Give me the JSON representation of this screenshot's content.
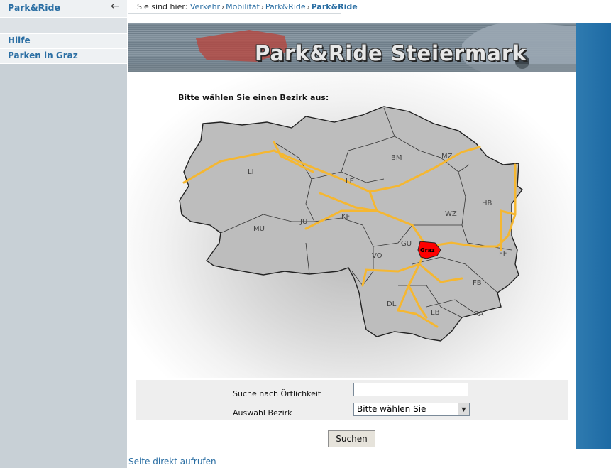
{
  "sidebar": {
    "title": "Park&Ride",
    "back_icon": "arrow-left-icon",
    "items": [
      {
        "label": "Hilfe"
      },
      {
        "label": "Parken in Graz"
      }
    ]
  },
  "breadcrumb": {
    "prefix": "Sie sind hier:",
    "items": [
      "Verkehr",
      "Mobilität",
      "Park&Ride"
    ],
    "current": "Park&Ride",
    "separator": "›"
  },
  "banner": {
    "title": "Park&Ride Steiermark"
  },
  "map": {
    "prompt": "Bitte wählen Sie einen Bezirk aus:",
    "districts": [
      "LI",
      "BM",
      "MZ",
      "LE",
      "HB",
      "KF",
      "WZ",
      "MU",
      "JU",
      "GU",
      "Graz",
      "FF",
      "VO",
      "FB",
      "DL",
      "LB",
      "RA"
    ],
    "highlighted": "Graz",
    "highlight_color": "#ff0000",
    "road_color": "#f5b731"
  },
  "search": {
    "location_label": "Suche nach Örtlichkeit",
    "location_value": "",
    "district_label": "Auswahl Bezirk",
    "district_selected": "Bitte wählen Sie",
    "button_label": "Suchen"
  },
  "footer": {
    "direct_link": "Seite direkt aufrufen"
  },
  "colors": {
    "link": "#2a6ea3",
    "sidebar_bg": "#c8d0d6",
    "accent_strip": "#2176ad"
  }
}
